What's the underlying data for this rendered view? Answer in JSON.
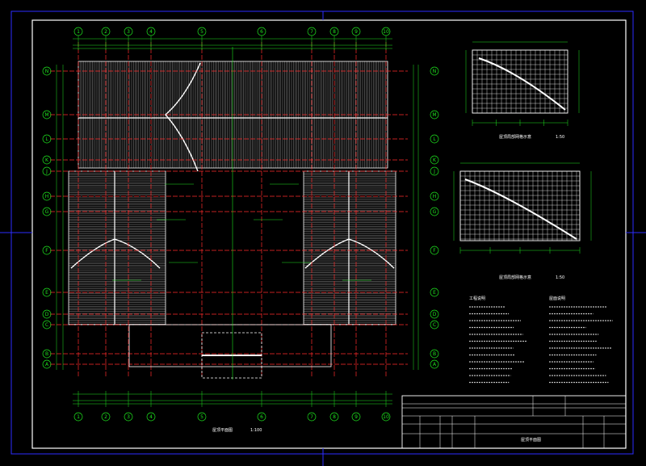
{
  "drawing": {
    "grid_columns": [
      "1",
      "2",
      "3",
      "4",
      "5",
      "6",
      "7",
      "8",
      "9",
      "10"
    ],
    "grid_rows": [
      "N",
      "M",
      "L",
      "K",
      "J",
      "H",
      "G",
      "F",
      "E",
      "D",
      "C",
      "B",
      "A"
    ],
    "notes_left_title": "工程说明",
    "notes_right_title": "屋面说明",
    "plan_title": "屋顶平面图",
    "plan_scale": "1:100",
    "detail1_title": "屋顶局部网格示意",
    "detail2_title": "屋顶局部网格示意",
    "detail_scale": "1:50",
    "title_block_name": "屋顶平面图",
    "colors": {
      "green": "#1ee31e",
      "red": "#ff2b2b",
      "white": "#ffffff",
      "blue_frame": "#2d2dff",
      "black": "#000000"
    }
  }
}
